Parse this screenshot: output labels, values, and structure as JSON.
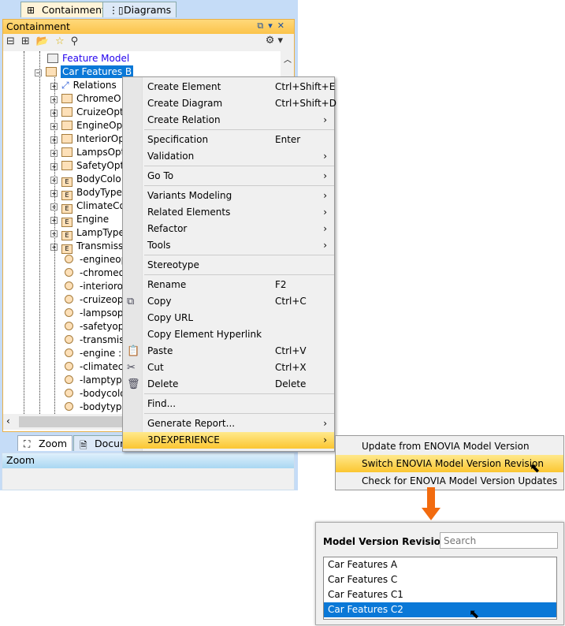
{
  "tabs": [
    {
      "label": "Containment",
      "icon": "containment-icon"
    },
    {
      "label": "Diagrams",
      "icon": "diagrams-icon"
    }
  ],
  "panel": {
    "title": "Containment"
  },
  "tree": [
    {
      "label": "Feature Model",
      "kind": "diagram",
      "level": 0,
      "link": true
    },
    {
      "label": "Car Features B",
      "kind": "package",
      "level": 0,
      "expanded": true,
      "selected": true
    },
    {
      "label": "Relations",
      "kind": "relations",
      "level": 1
    },
    {
      "label": "ChromeO",
      "kind": "class",
      "level": 1
    },
    {
      "label": "CruizeOpt",
      "kind": "class",
      "level": 1
    },
    {
      "label": "EngineOpt",
      "kind": "class",
      "level": 1
    },
    {
      "label": "InteriorOp",
      "kind": "class",
      "level": 1
    },
    {
      "label": "LampsOpt",
      "kind": "class",
      "level": 1
    },
    {
      "label": "SafetyOpt",
      "kind": "class",
      "level": 1
    },
    {
      "label": "BodyColo",
      "kind": "enum",
      "level": 1
    },
    {
      "label": "BodyType",
      "kind": "enum",
      "level": 1
    },
    {
      "label": "ClimateCo",
      "kind": "enum",
      "level": 1
    },
    {
      "label": "Engine",
      "kind": "enum",
      "level": 1
    },
    {
      "label": "LampType",
      "kind": "enum",
      "level": 1
    },
    {
      "label": "Transmiss",
      "kind": "enum",
      "level": 1
    },
    {
      "label": "-engineop",
      "kind": "property",
      "level": 1
    },
    {
      "label": "-chromeo",
      "kind": "property",
      "level": 1
    },
    {
      "label": "-interiorop",
      "kind": "property",
      "level": 1
    },
    {
      "label": "-cruizeopt",
      "kind": "property",
      "level": 1
    },
    {
      "label": "-lampsopt",
      "kind": "property",
      "level": 1
    },
    {
      "label": "-safetyopt",
      "kind": "property",
      "level": 1
    },
    {
      "label": "-transmiss",
      "kind": "property",
      "level": 1
    },
    {
      "label": "-engine : ",
      "kind": "property",
      "level": 1
    },
    {
      "label": "-climatec",
      "kind": "property",
      "level": 1
    },
    {
      "label": "-lamptype",
      "kind": "property",
      "level": 1
    },
    {
      "label": "-bodycolo",
      "kind": "property",
      "level": 1
    },
    {
      "label": "-bodytype",
      "kind": "property",
      "level": 1
    }
  ],
  "bottom_tabs": [
    {
      "label": "Zoom"
    },
    {
      "label": "Docum"
    }
  ],
  "zoom_panel": {
    "title": "Zoom"
  },
  "context_menu": [
    {
      "label": "Create Element",
      "shortcut": "Ctrl+Shift+E"
    },
    {
      "label": "Create Diagram",
      "shortcut": "Ctrl+Shift+D"
    },
    {
      "label": "Create Relation",
      "submenu": true,
      "sep_after": true
    },
    {
      "label": "Specification",
      "shortcut": "Enter"
    },
    {
      "label": "Validation",
      "submenu": true,
      "sep_after": true
    },
    {
      "label": "Go To",
      "submenu": true,
      "sep_after": true
    },
    {
      "label": "Variants Modeling",
      "submenu": true
    },
    {
      "label": "Related Elements",
      "submenu": true
    },
    {
      "label": "Refactor",
      "submenu": true
    },
    {
      "label": "Tools",
      "submenu": true,
      "sep_after": true
    },
    {
      "label": "Stereotype",
      "sep_after": true
    },
    {
      "label": "Rename",
      "shortcut": "F2"
    },
    {
      "label": "Copy",
      "shortcut": "Ctrl+C",
      "icon": "copy-icon"
    },
    {
      "label": "Copy URL"
    },
    {
      "label": "Copy Element Hyperlink"
    },
    {
      "label": "Paste",
      "shortcut": "Ctrl+V",
      "icon": "paste-icon"
    },
    {
      "label": "Cut",
      "shortcut": "Ctrl+X",
      "icon": "cut-icon"
    },
    {
      "label": "Delete",
      "shortcut": "Delete",
      "icon": "delete-icon",
      "sep_after": true
    },
    {
      "label": "Find...",
      "sep_after": true
    },
    {
      "label": "Generate Report...",
      "submenu": true
    },
    {
      "label": "3DEXPERIENCE",
      "submenu": true,
      "highlighted": true
    }
  ],
  "submenu": [
    {
      "label": "Update from ENOVIA Model Version"
    },
    {
      "label": "Switch ENOVIA Model Version Revision",
      "highlighted": true
    },
    {
      "label": "Check for ENOVIA Model Version Updates"
    }
  ],
  "dialog": {
    "label": "Model Version Revisions:",
    "search_placeholder": "Search",
    "items": [
      "Car Features A",
      "Car Features C",
      "Car Features C1",
      "Car Features C2"
    ],
    "selected": "Car Features C2"
  },
  "colors": {
    "selection": "#0a78d7",
    "highlight": "#fbc631",
    "arrow": "#f26b0f",
    "link": "#2200ee"
  }
}
